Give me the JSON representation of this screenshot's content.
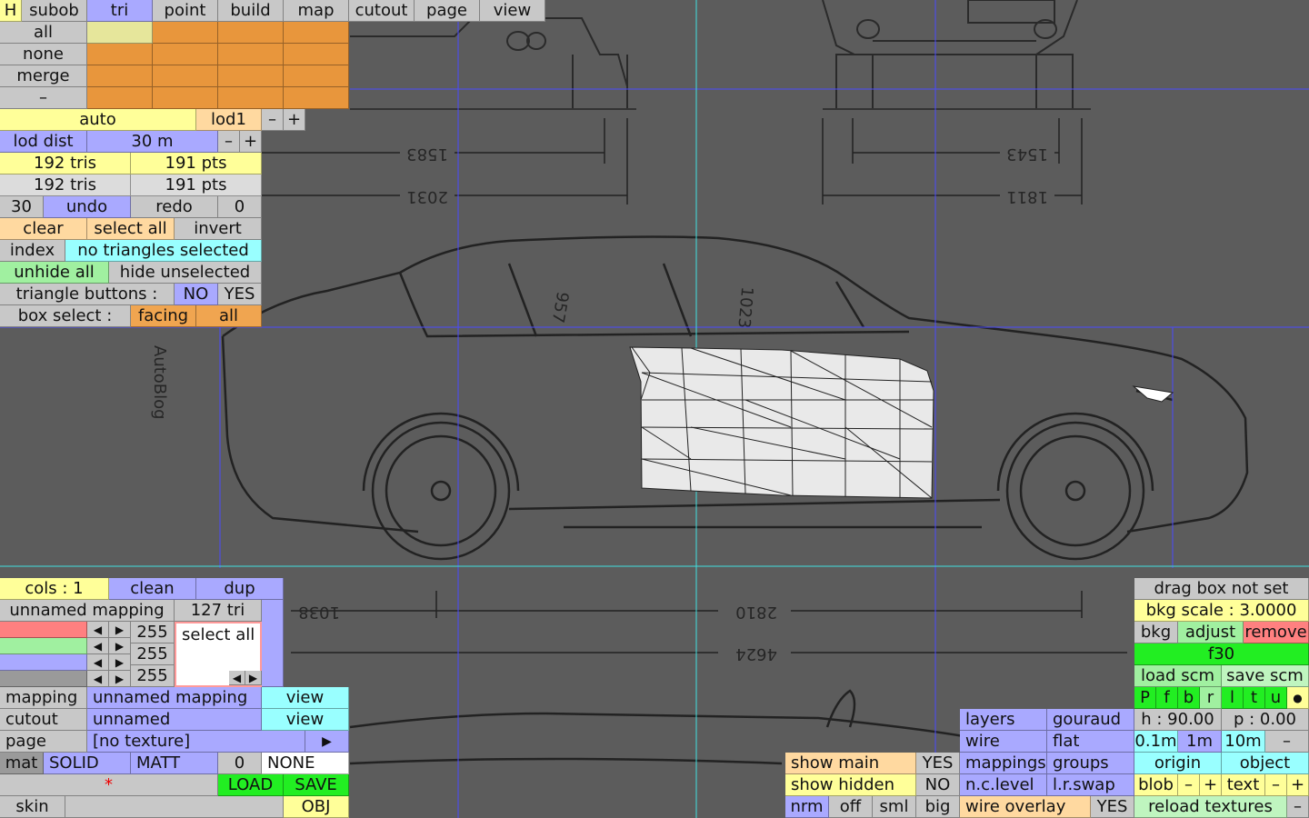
{
  "menu": {
    "h": "H",
    "items": [
      "subob",
      "tri",
      "point",
      "build",
      "map",
      "cutout",
      "page",
      "view"
    ]
  },
  "select": {
    "all": "all",
    "none": "none",
    "merge": "merge",
    "dash": "–"
  },
  "lod": {
    "auto": "auto",
    "lod1": "lod1",
    "minus": "–",
    "plus": "+",
    "lod_dist": "lod dist",
    "dist_value": "30 m"
  },
  "counts": {
    "tris1": "192 tris",
    "pts1": "191 pts",
    "tris2": "192 tris",
    "pts2": "191 pts"
  },
  "undo": {
    "count": "30",
    "undo": "undo",
    "redo": "redo",
    "redo_count": "0"
  },
  "sel": {
    "clear": "clear",
    "select_all": "select all",
    "invert": "invert",
    "index": "index",
    "status": "no triangles selected",
    "unhide_all": "unhide all",
    "hide_unselected": "hide unselected",
    "tri_buttons": "triangle buttons :",
    "no": "NO",
    "yes": "YES",
    "box_select": "box select :",
    "facing": "facing",
    "all": "all"
  },
  "mapping": {
    "cols": "cols : 1",
    "clean": "clean",
    "dup": "dup",
    "name": "unnamed mapping",
    "tri": "127 tri",
    "r": "255",
    "g": "255",
    "b": "255",
    "select_all": "select all",
    "colors": {
      "r": "#ff8c7a",
      "g": "#a3f59a",
      "b": "#9f9cff",
      "gray": "#9a9a9a"
    }
  },
  "props": {
    "mapping_label": "mapping",
    "mapping_value": "unnamed mapping",
    "view1": "view",
    "cutout_label": "cutout",
    "cutout_value": "unnamed",
    "view2": "view",
    "page_label": "page",
    "page_value": "[no texture]",
    "mat": "mat",
    "solid": "SOLID",
    "matt": "MATT",
    "num": "0",
    "none": "NONE",
    "star": "*",
    "load": "LOAD",
    "save": "SAVE",
    "skin": "skin",
    "obj": "OBJ"
  },
  "show": {
    "main": "show main",
    "main_val": "YES",
    "hidden": "show hidden",
    "hidden_val": "NO",
    "nrm": "nrm",
    "off": "off",
    "sml": "sml",
    "big": "big"
  },
  "layers": {
    "layers": "layers",
    "gouraud": "gouraud",
    "wire": "wire",
    "flat": "flat",
    "mappings": "mappings",
    "groups": "groups",
    "nc_level": "n.c.level",
    "lr_swap": "l.r.swap",
    "wire_overlay": "wire overlay",
    "wire_overlay_val": "YES"
  },
  "bkg": {
    "drag": "drag box not set",
    "scale": "bkg scale : 3.0000",
    "bkg": "bkg",
    "adjust": "adjust",
    "remove": "remove",
    "f30": "f30",
    "load_scm": "load scm",
    "save_scm": "save scm",
    "views": [
      "P",
      "f",
      "b",
      "r",
      "l",
      "t",
      "u"
    ],
    "dot": "●",
    "h": "h : 90.00",
    "p": "p : 0.00",
    "s01": "0.1m",
    "s1": "1m",
    "s10": "10m",
    "dash": "–",
    "origin": "origin",
    "object": "object",
    "blob": "blob",
    "minus": "–",
    "plus": "+",
    "text": "text",
    "reload": "reload textures"
  },
  "drawing": {
    "dims": [
      "1583",
      "1543",
      "2031",
      "1811",
      "957",
      "1023",
      "1038",
      "2810",
      "4624"
    ],
    "brand": "AutoBlog"
  }
}
